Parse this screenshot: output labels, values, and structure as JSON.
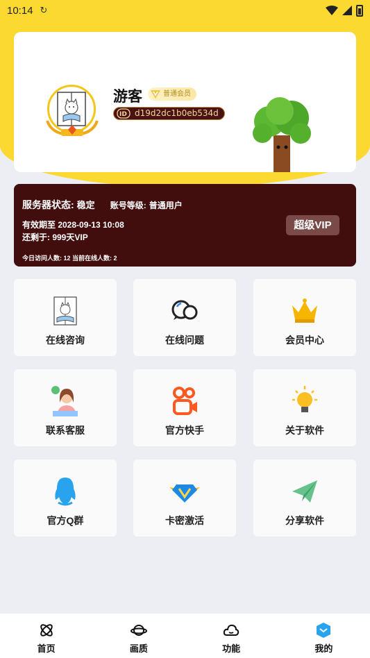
{
  "status_bar": {
    "time": "10:14",
    "sync_icon": "sync-icon",
    "wifi_icon": "wifi-icon",
    "signal_icon": "signal-icon",
    "battery_icon": "battery-icon"
  },
  "profile": {
    "username": "游客",
    "member_level": "普通会员",
    "user_id": "d19d2dc1b0eb534d",
    "avatar_icon": "cat-reading-avatar"
  },
  "server": {
    "status_label": "服务器状态:",
    "status_value": "稳定",
    "level_label": "账号等级:",
    "level_value": "普通用户",
    "expire_text": "有效期至 2028-09-13 10:08",
    "remain_text": "还剩于: 999天VIP",
    "visitors_text": "今日访问人数: 12 当前在线人数: 2",
    "vip_button": "超级VIP"
  },
  "tiles": [
    {
      "label": "在线咨询",
      "icon": "cat-reading-icon"
    },
    {
      "label": "在线问题",
      "icon": "chat-bubbles-icon"
    },
    {
      "label": "会员中心",
      "icon": "crown-icon"
    },
    {
      "label": "联系客服",
      "icon": "customer-service-icon"
    },
    {
      "label": "官方快手",
      "icon": "kuaishou-icon"
    },
    {
      "label": "关于软件",
      "icon": "lightbulb-icon"
    },
    {
      "label": "官方Q群",
      "icon": "qq-penguin-icon"
    },
    {
      "label": "卡密激活",
      "icon": "vip-diamond-icon"
    },
    {
      "label": "分享软件",
      "icon": "paper-plane-icon"
    }
  ],
  "bottom_nav": [
    {
      "label": "首页",
      "icon": "atom-icon"
    },
    {
      "label": "画质",
      "icon": "planet-icon"
    },
    {
      "label": "功能",
      "icon": "cloud-icon"
    },
    {
      "label": "我的",
      "icon": "cube-icon",
      "active": true
    }
  ],
  "colors": {
    "brand_yellow": "#fbd930",
    "server_card": "#420d0d",
    "vip_button": "#7a4a48",
    "active_nav": "#2aa3ef"
  }
}
